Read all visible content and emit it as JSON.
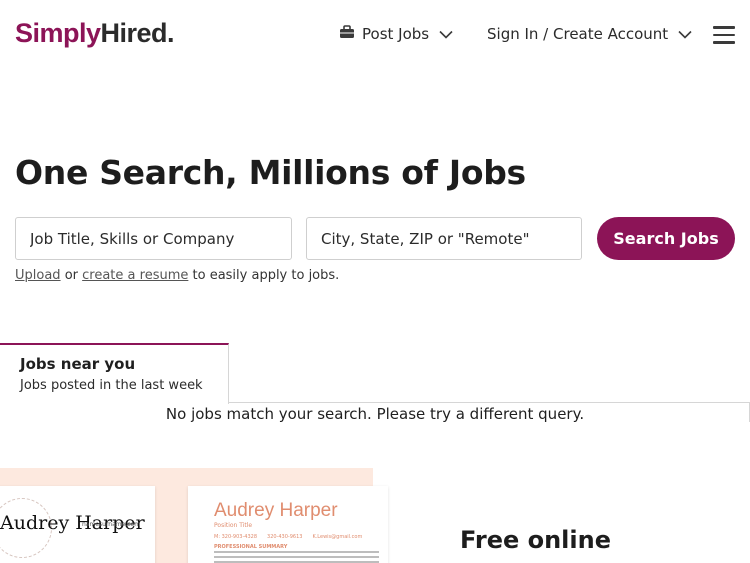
{
  "brand": {
    "part1": "Simply",
    "part2": "Hired.",
    "primary_color": "#8c1457"
  },
  "nav": {
    "post_jobs": "Post Jobs",
    "sign_in": "Sign In / Create Account",
    "post_icon": "briefcase-icon",
    "menu_icon": "hamburger-menu-icon"
  },
  "search": {
    "headline": "One Search, Millions of Jobs",
    "query_placeholder": "Job Title, Skills or Company",
    "location_placeholder": "City, State, ZIP or \"Remote\"",
    "button_label": "Search Jobs",
    "helper_upload": "Upload",
    "helper_or": " or ",
    "helper_create": "create a resume",
    "helper_rest": " to easily apply to jobs."
  },
  "jobs_tab": {
    "title": "Jobs near you",
    "subtitle": "Jobs posted in the last week",
    "empty_message": "No jobs match your search. Please try a different query."
  },
  "promo": {
    "resume1_name": "Audrey Harper",
    "resume1_url": "namesurname.com",
    "resume2_name": "Audrey Harper",
    "resume2_role": "Position Title",
    "resume2_phone1": "M: 320-903-4328",
    "resume2_phone2": "320-430-9613",
    "resume2_email": "K.Lewis@gmail.com",
    "resume2_section": "PROFESSIONAL SUMMARY",
    "title": "Free online"
  }
}
